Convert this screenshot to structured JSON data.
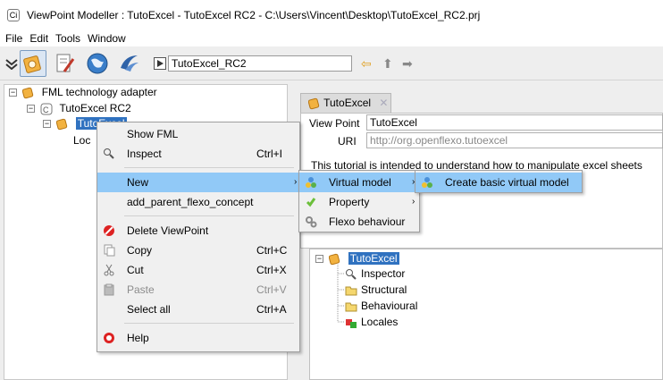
{
  "window": {
    "title": "ViewPoint Modeller : TutoExcel - TutoExcel RC2 - C:\\Users\\Vincent\\Desktop\\TutoExcel_RC2.prj",
    "app_icon_text": "Ci"
  },
  "menubar": [
    "File",
    "Edit",
    "Tools",
    "Window"
  ],
  "toolbar": {
    "modules": [
      {
        "icon": "viewpoint-modeller-icon",
        "active": true
      },
      {
        "icon": "document-editor-icon",
        "active": false
      },
      {
        "icon": "globe-icon",
        "active": false
      },
      {
        "icon": "openoffice-gull-icon",
        "active": false
      }
    ],
    "project_field": "TutoExcel_RC2",
    "nav_icons": [
      "back-arrow-icon",
      "up-arrow-icon",
      "forward-arrow-icon"
    ]
  },
  "left_tree": {
    "root": "FML technology adapter",
    "child": "TutoExcel RC2",
    "selected": "TutoExcel",
    "locales_partial": "Loc"
  },
  "context_menu": {
    "items": [
      {
        "label": "Show FML",
        "shortcut": ""
      },
      {
        "label": "Inspect",
        "shortcut": "Ctrl+I",
        "icon": "magnifier-icon"
      },
      {
        "label": "New",
        "shortcut": "",
        "submenu": true,
        "highlighted": true
      },
      {
        "label": "add_parent_flexo_concept",
        "shortcut": ""
      },
      {
        "label": "Delete ViewPoint",
        "shortcut": "",
        "icon": "delete-icon"
      },
      {
        "label": "Copy",
        "shortcut": "Ctrl+C",
        "icon": "copy-icon"
      },
      {
        "label": "Cut",
        "shortcut": "Ctrl+X",
        "icon": "cut-icon"
      },
      {
        "label": "Paste",
        "shortcut": "Ctrl+V",
        "icon": "paste-icon",
        "disabled": true
      },
      {
        "label": "Select all",
        "shortcut": "Ctrl+A"
      },
      {
        "label": "Help",
        "shortcut": "",
        "icon": "help-icon"
      }
    ]
  },
  "new_submenu": {
    "items": [
      {
        "label": "Virtual model",
        "submenu": true,
        "highlighted": true
      },
      {
        "label": "Property",
        "submenu": true
      },
      {
        "label": "Flexo behaviour"
      }
    ]
  },
  "virtual_model_submenu": {
    "items": [
      {
        "label": "Create basic virtual model",
        "highlighted": true
      }
    ]
  },
  "editor": {
    "tab_label": "TutoExcel",
    "viewpoint_label": "View Point",
    "viewpoint_value": "TutoExcel",
    "uri_label": "URI",
    "uri_value": "http://org.openflexo.tutoexcel",
    "description": "This tutorial is intended to understand how to manipulate excel sheets"
  },
  "lower_tree": {
    "root": "TutoExcel",
    "children": [
      "Inspector",
      "Structural",
      "Behavioural",
      "Locales"
    ]
  }
}
